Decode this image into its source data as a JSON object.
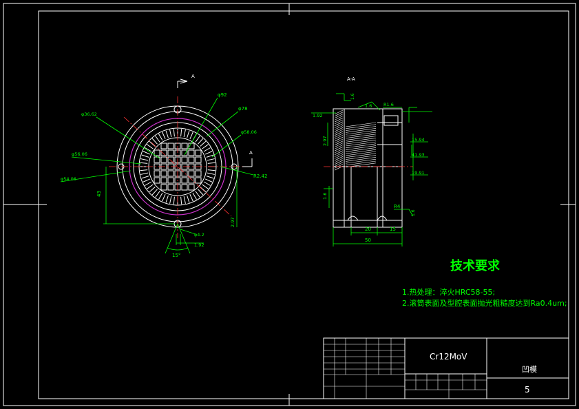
{
  "colors": {
    "background": "#000000",
    "frame": "#ffffff",
    "dimension": "#00ff00",
    "centerline": "#ff3333",
    "pitch_circle": "#cc33cc",
    "title_text": "#00ff00"
  },
  "views": {
    "section_marker_top": "A",
    "section_marker_right": "A",
    "section_title": "A-A"
  },
  "front_dims": {
    "d92": "φ92",
    "d78": "φ78",
    "d36": "φ36.62",
    "d58": "φ58.06",
    "d56": "φ56.06",
    "d54": "φ54.06",
    "h43": "43",
    "r242": "R2.42",
    "d4": "φ4.2",
    "w192": "1.92",
    "w297": "2.97",
    "ang15": "15°"
  },
  "side_dims": {
    "c192": "1.92",
    "c16": "1.6",
    "r16": "R1.6",
    "v297": "2.97",
    "d1594": "15.94",
    "d4193": "41.93",
    "d1991": "19.91",
    "v16": "1.6",
    "r4": "R4",
    "n20": "20",
    "n15": "15",
    "n50": "50",
    "rough16": "1.6",
    "rough16b": "1.6"
  },
  "tech": {
    "heading": "技术要求",
    "line1": "1.热处理：淬火HRC58-55;",
    "line2": "2.滚筒表面及型腔表面抛光粗糙度达到Ra0.4um;"
  },
  "title_block": {
    "material": "Cr12MoV",
    "drawing_name": "凹模",
    "sheet_no": "5"
  }
}
